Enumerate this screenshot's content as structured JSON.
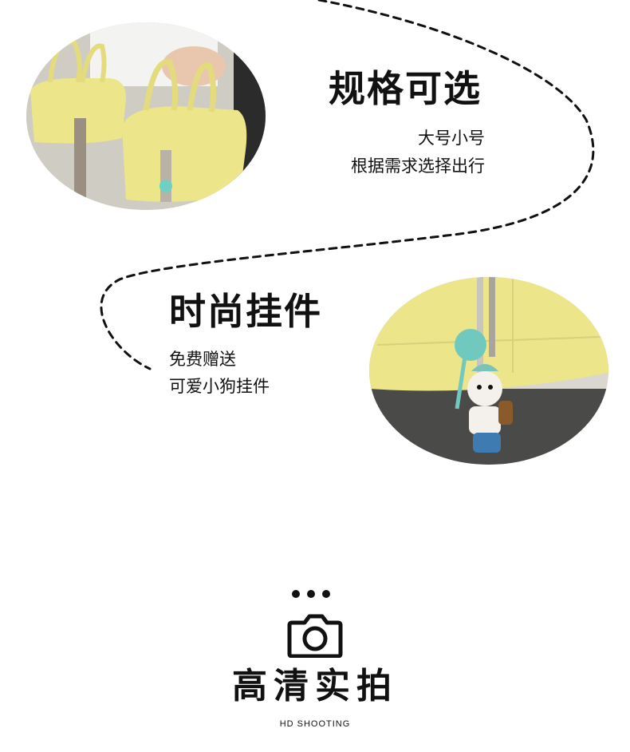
{
  "section_specs": {
    "title": "规格可选",
    "line1": "大号小号",
    "line2": "根据需求选择出行"
  },
  "section_charm": {
    "title": "时尚挂件",
    "line1": "免费赠送",
    "line2": "可爱小狗挂件"
  },
  "footer": {
    "title": "高清实拍",
    "subtitle": "HD SHOOTING"
  },
  "colors": {
    "bag_yellow": "#ece58a",
    "text": "#111111"
  }
}
